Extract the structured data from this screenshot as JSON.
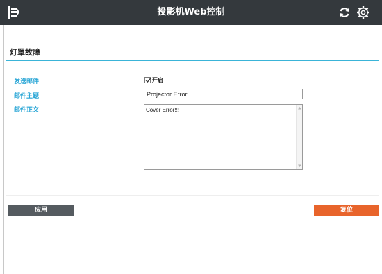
{
  "header": {
    "title": "投影机Web控制",
    "icons": {
      "menu": "menu-icon",
      "refresh": "refresh-icon",
      "settings": "gear-icon"
    }
  },
  "section": {
    "title": "灯罩故障"
  },
  "form": {
    "send_label": "发送邮件",
    "subject_label": "邮件主题",
    "body_label": "邮件正文",
    "enable_checkbox": {
      "label": "开启",
      "checked": true
    },
    "subject_value": "Projector Error",
    "body_value": "Cover Error!!!"
  },
  "actions": {
    "apply_label": "应用",
    "reset_label": "复位"
  },
  "colors": {
    "header_bg": "#34393d",
    "accent": "#2aa6d6",
    "apply_bg": "#555b60",
    "reset_bg": "#e8642b"
  }
}
